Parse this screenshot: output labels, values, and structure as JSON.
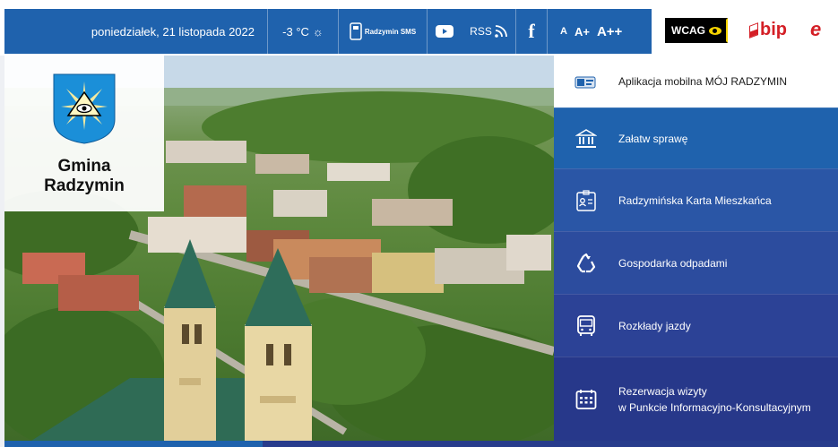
{
  "topbar": {
    "date": "poniedziałek, 21 listopada 2022",
    "weather": "-3 °C",
    "sms_label": "Radzymin SMS",
    "rss_label": "RSS",
    "facebook_label": "f",
    "font_small": "A",
    "font_medium": "A+",
    "font_large": "A++",
    "wcag_label": "WCAG",
    "bip_label": "bip",
    "epuap_label": "e"
  },
  "logo": {
    "line1": "Gmina",
    "line2": "Radzymin"
  },
  "menu": {
    "items": [
      {
        "label": "Aplikacja mobilna MÓJ RADZYMIN",
        "icon": "phone-app-icon"
      },
      {
        "label": "Załatw sprawę",
        "icon": "bank-building-icon"
      },
      {
        "label": "Radzymińska Karta Mieszkańca",
        "icon": "id-card-icon"
      },
      {
        "label": "Gospodarka odpadami",
        "icon": "recycle-icon"
      },
      {
        "label": "Rozkłady jazdy",
        "icon": "bus-icon"
      },
      {
        "label_line1": "Rezerwacja wizyty",
        "label_line2": "w Punkcie Informacyjno-Konsultacyjnym",
        "icon": "calendar-icon"
      }
    ]
  },
  "colors": {
    "topbar_blue": "#1f62ad",
    "menu_blue": "#2a56a6",
    "bip_red": "#d41f26",
    "wcag_yellow": "#f5d300"
  }
}
